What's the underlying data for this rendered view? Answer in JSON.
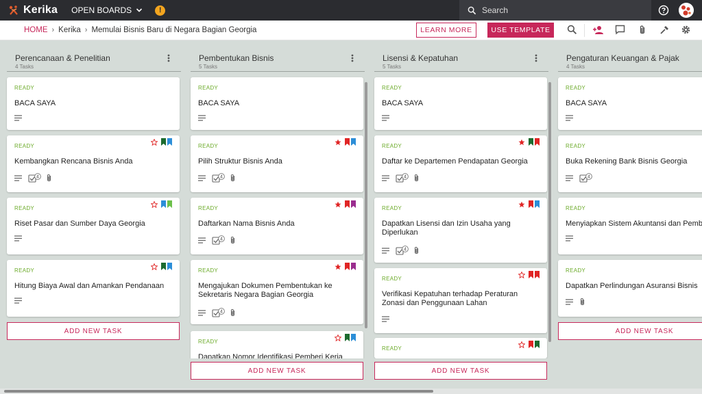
{
  "app": {
    "name": "Kerika",
    "boards_menu": "OPEN BOARDS",
    "alert": "!"
  },
  "search": {
    "placeholder": "Search"
  },
  "breadcrumb": {
    "home": "HOME",
    "org": "Kerika",
    "board": "Memulai Bisnis Baru di Negara Bagian Georgia"
  },
  "toolbar": {
    "learn_more": "LEARN MORE",
    "use_template": "USE TEMPLATE"
  },
  "colors": {
    "accent": "#c7275a",
    "ready": "#6cab2a",
    "topbar": "#2b2c30",
    "background": "#d5dcd8"
  },
  "add_task_label": "ADD NEW TASK",
  "columns": [
    {
      "title": "Perencanaan & Penelitian",
      "count": "4 Tasks",
      "cards": [
        {
          "status": "READY",
          "title": "BACA SAYA",
          "flags": [],
          "checklist": null,
          "attachment": false
        },
        {
          "status": "READY",
          "title": "Kembangkan Rencana Bisnis Anda",
          "flags": [
            "star-outline",
            "green",
            "blue"
          ],
          "checklist": "4",
          "attachment": true
        },
        {
          "status": "READY",
          "title": "Riset Pasar dan Sumber Daya Georgia",
          "flags": [
            "star-outline",
            "blue",
            "lightgreen"
          ],
          "checklist": null,
          "attachment": false
        },
        {
          "status": "READY",
          "title": "Hitung Biaya Awal dan Amankan Pendanaan",
          "flags": [
            "star-outline",
            "green",
            "blue"
          ],
          "checklist": null,
          "attachment": false
        }
      ]
    },
    {
      "title": "Pembentukan Bisnis",
      "count": "5 Tasks",
      "cards": [
        {
          "status": "READY",
          "title": "BACA SAYA",
          "flags": [],
          "checklist": null,
          "attachment": false
        },
        {
          "status": "READY",
          "title": "Pilih Struktur Bisnis Anda",
          "flags": [
            "star",
            "red",
            "blue"
          ],
          "checklist": "4",
          "attachment": true
        },
        {
          "status": "READY",
          "title": "Daftarkan Nama Bisnis Anda",
          "flags": [
            "star",
            "red",
            "purple"
          ],
          "checklist": "4",
          "attachment": true
        },
        {
          "status": "READY",
          "title": "Mengajukan Dokumen Pembentukan ke Sekretaris Negara Bagian Georgia",
          "flags": [
            "star",
            "red",
            "purple"
          ],
          "checklist": "4",
          "attachment": true
        },
        {
          "status": "READY",
          "title": "Dapatkan Nomor Identifikasi Pemberi Kerja",
          "flags": [
            "star-outline",
            "green",
            "blue"
          ],
          "checklist": null,
          "attachment": false
        }
      ]
    },
    {
      "title": "Lisensi & Kepatuhan",
      "count": "5 Tasks",
      "cards": [
        {
          "status": "READY",
          "title": "BACA SAYA",
          "flags": [],
          "checklist": null,
          "attachment": false
        },
        {
          "status": "READY",
          "title": "Daftar ke Departemen Pendapatan Georgia",
          "flags": [
            "star",
            "green",
            "red"
          ],
          "checklist": "4",
          "attachment": true
        },
        {
          "status": "READY",
          "title": "Dapatkan Lisensi dan Izin Usaha yang Diperlukan",
          "flags": [
            "star",
            "red",
            "blue"
          ],
          "checklist": "4",
          "attachment": true
        },
        {
          "status": "READY",
          "title": "Verifikasi Kepatuhan terhadap Peraturan Zonasi dan Penggunaan Lahan",
          "flags": [
            "star-outline",
            "red",
            "red"
          ],
          "checklist": null,
          "attachment": false
        },
        {
          "status": "READY",
          "title": "",
          "flags": [
            "star-outline",
            "red",
            "green"
          ],
          "checklist": null,
          "attachment": false
        }
      ]
    },
    {
      "title": "Pengaturan Keuangan & Pajak",
      "count": "4 Tasks",
      "cards": [
        {
          "status": "READY",
          "title": "BACA SAYA",
          "flags": [],
          "checklist": null,
          "attachment": false
        },
        {
          "status": "READY",
          "title": "Buka Rekening Bank Bisnis Georgia",
          "flags": [],
          "checklist": "4",
          "attachment": false
        },
        {
          "status": "READY",
          "title": "Menyiapkan Sistem Akuntansi dan Pembukuan",
          "flags": [],
          "checklist": null,
          "attachment": false
        },
        {
          "status": "READY",
          "title": "Dapatkan Perlindungan Asuransi Bisnis",
          "flags": [],
          "checklist": null,
          "attachment": true
        }
      ]
    }
  ]
}
